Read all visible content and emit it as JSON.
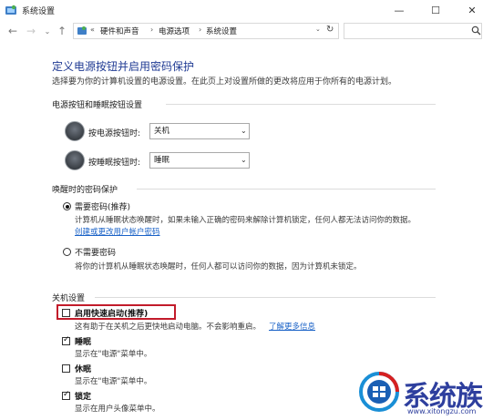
{
  "window": {
    "title": "系统设置",
    "minimize": "—",
    "maximize": "☐",
    "close": "✕"
  },
  "nav": {
    "back": "←",
    "forward": "→",
    "history": "⌄",
    "up": "↑",
    "overflow": "«",
    "breadcrumbs": [
      "硬件和声音",
      "电源选项",
      "系统设置"
    ],
    "separator": "›",
    "dropdown": "⌄",
    "refresh": "↻"
  },
  "page": {
    "title": "定义电源按钮并启用密码保护",
    "description": "选择要为你的计算机设置的电源设置。在此页上对设置所做的更改将应用于你所有的电源计划。"
  },
  "power_section": {
    "label": "电源按钮和睡眠按钮设置",
    "rows": [
      {
        "label": "按电源按钮时:",
        "value": "关机"
      },
      {
        "label": "按睡眠按钮时:",
        "value": "睡眠"
      }
    ]
  },
  "password_section": {
    "label": "唤醒时的密码保护",
    "options": [
      {
        "title": "需要密码(推荐)",
        "desc": "计算机从睡眠状态唤醒时，如果未输入正确的密码来解除计算机锁定，任何人都无法访问你的数据。",
        "link": "创建或更改用户帐户密码",
        "selected": true
      },
      {
        "title": "不需要密码",
        "desc": "将你的计算机从睡眠状态唤醒时，任何人都可以访问你的数据，因为计算机未锁定。",
        "selected": false
      }
    ]
  },
  "shutdown_section": {
    "label": "关机设置",
    "items": [
      {
        "title": "启用快速启动(推荐)",
        "desc": "这有助于在关机之后更快地启动电脑。不会影响重启。",
        "link": "了解更多信息",
        "checked": false
      },
      {
        "title": "睡眠",
        "desc": "显示在\"电源\"菜单中。",
        "checked": true
      },
      {
        "title": "休眠",
        "desc": "显示在\"电源\"菜单中。",
        "checked": false
      },
      {
        "title": "锁定",
        "desc": "显示在用户头像菜单中。",
        "checked": true
      }
    ]
  },
  "watermark": {
    "text": "系统族",
    "url": "www.xitongzu.com"
  },
  "colors": {
    "title_blue": "#1f3a93",
    "link_blue": "#1a62c7",
    "highlight_red": "#c21b2a",
    "watermark_blue": "#2e3f9e"
  }
}
